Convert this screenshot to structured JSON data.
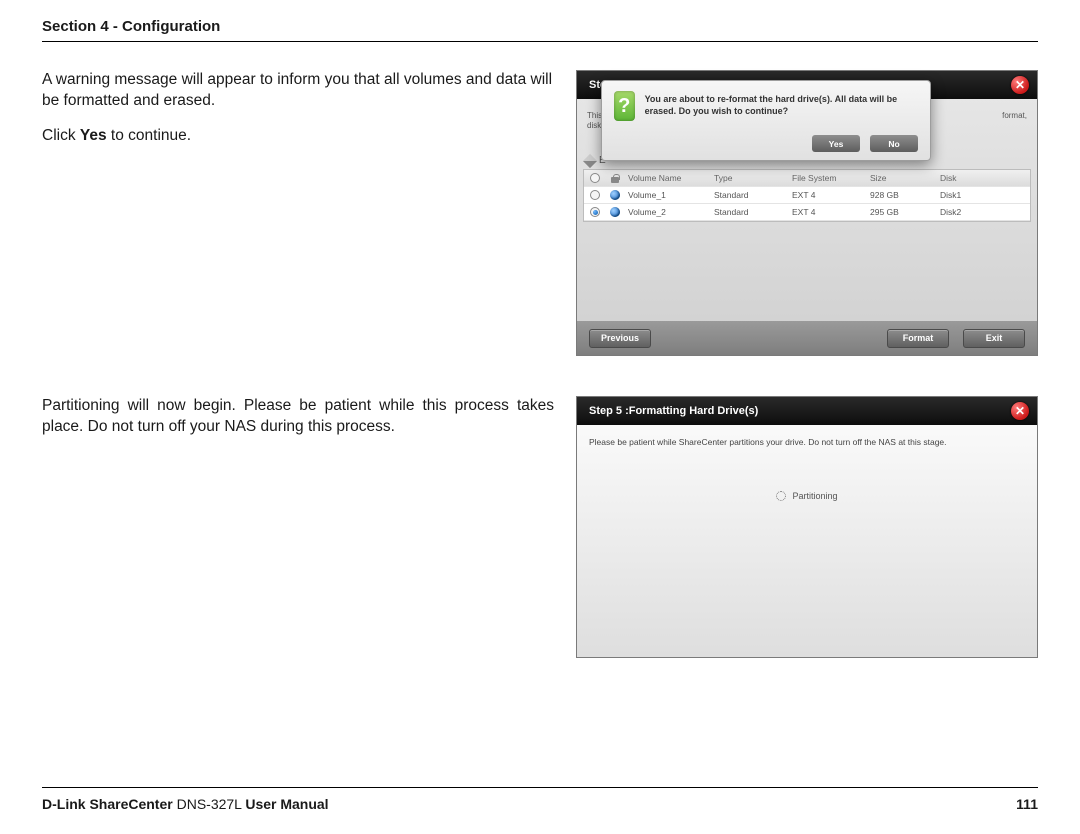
{
  "header": {
    "section_title": "Section 4 - Configuration"
  },
  "block1": {
    "para1": "A warning message will appear to inform you that all volumes and data will be formatted and erased.",
    "para2_prefix": "Click ",
    "para2_bold": "Yes",
    "para2_suffix": " to continue."
  },
  "shot1": {
    "title_visible": "Ste",
    "bg_line1": "This s",
    "bg_line2": "disk a",
    "bg_trail": "format,",
    "edit_label": "E",
    "table": {
      "headers": {
        "name": "Volume Name",
        "type": "Type",
        "fs": "File System",
        "size": "Size",
        "disk": "Disk"
      },
      "rows": [
        {
          "name": "Volume_1",
          "type": "Standard",
          "fs": "EXT 4",
          "size": "928 GB",
          "disk": "Disk1",
          "selected": false
        },
        {
          "name": "Volume_2",
          "type": "Standard",
          "fs": "EXT 4",
          "size": "295 GB",
          "disk": "Disk2",
          "selected": true
        }
      ]
    },
    "footer": {
      "previous": "Previous",
      "format": "Format",
      "exit": "Exit"
    },
    "modal": {
      "text": "You are about to re-format the hard drive(s). All data will be erased. Do you wish to continue?",
      "yes": "Yes",
      "no": "No"
    }
  },
  "block2": {
    "para": "Partitioning will now begin. Please be patient while this process takes place. Do not turn off your NAS during this process."
  },
  "shot2": {
    "title": "Step 5 :Formatting Hard Drive(s)",
    "msg": "Please be patient while ShareCenter partitions your drive. Do not turn off the NAS at this stage.",
    "status": "Partitioning"
  },
  "footer": {
    "brand_bold1": "D-Link ShareCenter",
    "model": " DNS-327L ",
    "brand_bold2": "User Manual",
    "page": "111"
  }
}
